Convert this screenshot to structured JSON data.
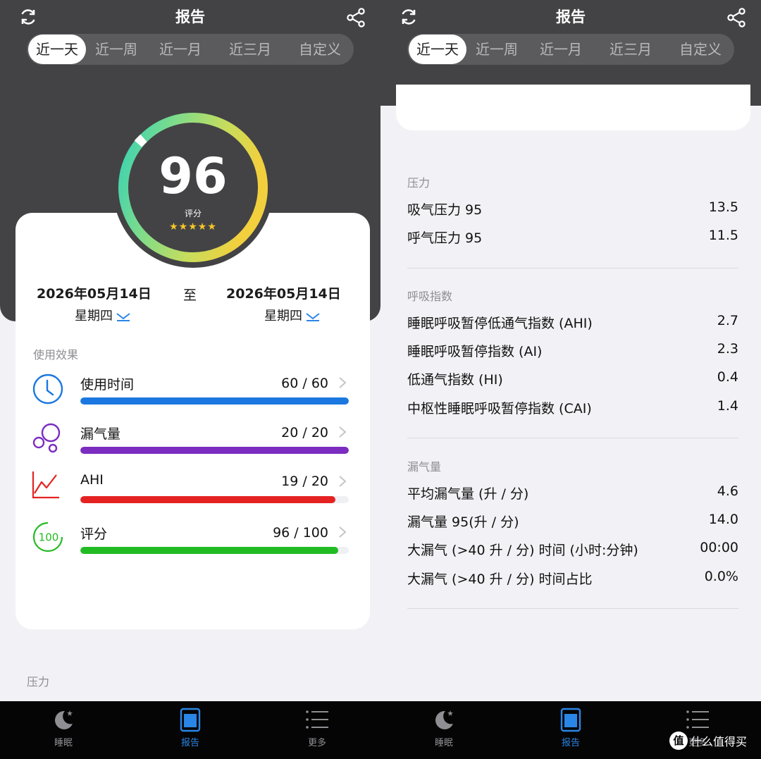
{
  "app": {
    "title": "报告"
  },
  "range_tabs": [
    "近一天",
    "近一周",
    "近一月",
    "近三月",
    "自定义"
  ],
  "score": {
    "value": "96",
    "label": "评分",
    "stars": "★★★★★",
    "gauge_colors": [
      "#35d1b6",
      "#7fdc8a",
      "#c8dd5c",
      "#f2cf3d"
    ]
  },
  "date_range": {
    "start_date": "2026年05月14日",
    "start_weekday": "星期四",
    "to": "至",
    "end_date": "2026年05月14日",
    "end_weekday": "星期四"
  },
  "usage_effect": {
    "section_label": "使用效果",
    "metrics": [
      {
        "name": "使用时间",
        "value": "60 / 60",
        "icon": "clock-icon",
        "fill": 1.0,
        "color": "#1a78e0"
      },
      {
        "name": "漏气量",
        "value": "20 / 20",
        "icon": "bubbles-icon",
        "fill": 1.0,
        "color": "#7b2dbf"
      },
      {
        "name": "AHI",
        "value": "19 / 20",
        "icon": "trend-chart-icon",
        "fill": 0.95,
        "color": "#e52222"
      },
      {
        "name": "评分",
        "value": "96 / 100",
        "icon": "score-100-icon",
        "icon_text": "100",
        "fill": 0.96,
        "color": "#22bb22"
      }
    ]
  },
  "left_peek": {
    "section_label": "压力"
  },
  "pressure": {
    "section_label": "压力",
    "rows": [
      {
        "name": "吸气压力 95",
        "value": "13.5"
      },
      {
        "name": "呼气压力 95",
        "value": "11.5"
      }
    ]
  },
  "respiratory_index": {
    "section_label": "呼吸指数",
    "rows": [
      {
        "name": "睡眠呼吸暂停低通气指数 (AHI)",
        "value": "2.7"
      },
      {
        "name": "睡眠呼吸暂停指数 (AI)",
        "value": "2.3"
      },
      {
        "name": "低通气指数 (HI)",
        "value": "0.4"
      },
      {
        "name": "中枢性睡眠呼吸暂停指数 (CAI)",
        "value": "1.4"
      }
    ]
  },
  "leak": {
    "section_label": "漏气量",
    "rows": [
      {
        "name": "平均漏气量 (升 / 分)",
        "value": "4.6"
      },
      {
        "name": "漏气量 95(升 / 分)",
        "value": "14.0"
      },
      {
        "name": "大漏气 (>40 升 / 分) 时间 (小时:分钟)",
        "value": "00:00"
      },
      {
        "name": "大漏气 (>40 升 / 分) 时间占比",
        "value": "0.0%"
      }
    ]
  },
  "bottom_nav": [
    {
      "label": "睡眠",
      "icon": "moon-icon",
      "active": false
    },
    {
      "label": "报告",
      "icon": "report-icon",
      "active": true
    },
    {
      "label": "更多",
      "icon": "menu-list-icon",
      "active": false
    }
  ],
  "watermark": {
    "logo": "值",
    "text": "什么值得买"
  }
}
